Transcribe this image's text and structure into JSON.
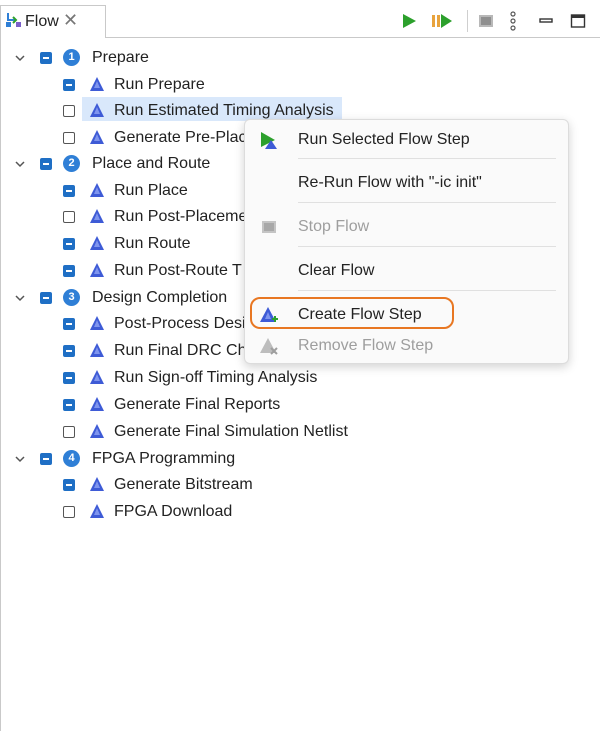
{
  "tab": {
    "title": "Flow",
    "close_glyph": "✕",
    "icon": "flow-navigator-icon"
  },
  "toolbar": {
    "buttons": [
      {
        "name": "run-flow-icon",
        "color": "#2ca02c"
      },
      {
        "name": "run-selected-step-icon",
        "color": "#2ca02c"
      },
      {
        "name": "stop-icon",
        "color": "#9e9e9e"
      },
      {
        "name": "view-menu-icon"
      },
      {
        "name": "minimize-icon"
      },
      {
        "name": "maximize-icon"
      }
    ]
  },
  "tree": {
    "stages": [
      {
        "number": "1",
        "label": "Prepare",
        "checked": true,
        "steps": [
          {
            "label": "Run Prepare",
            "checked": true
          },
          {
            "label": "Run Estimated Timing Analysis",
            "checked": false,
            "selected": true
          },
          {
            "label": "Generate Pre-Plac",
            "checked": false
          }
        ]
      },
      {
        "number": "2",
        "label": "Place and Route",
        "checked": true,
        "steps": [
          {
            "label": "Run Place",
            "checked": true
          },
          {
            "label": "Run Post-Placeme",
            "checked": false
          },
          {
            "label": "Run Route",
            "checked": true
          },
          {
            "label": "Run Post-Route T",
            "checked": true
          }
        ]
      },
      {
        "number": "3",
        "label": "Design Completion",
        "checked": true,
        "steps": [
          {
            "label": "Post-Process Desi",
            "checked": true
          },
          {
            "label": "Run Final DRC Ch",
            "checked": true
          },
          {
            "label": "Run Sign-off Timing Analysis",
            "checked": true
          },
          {
            "label": "Generate Final Reports",
            "checked": true
          },
          {
            "label": "Generate Final Simulation Netlist",
            "checked": false
          }
        ]
      },
      {
        "number": "4",
        "label": "FPGA Programming",
        "checked": true,
        "steps": [
          {
            "label": "Generate Bitstream",
            "checked": true
          },
          {
            "label": "FPGA Download",
            "checked": false
          }
        ]
      }
    ]
  },
  "context_menu": {
    "items": [
      {
        "label": "Run Selected Flow Step",
        "icon": "run-selected-step-icon",
        "enabled": true
      },
      {
        "label": "Re-Run Flow with \"-ic init\"",
        "icon": "",
        "enabled": true
      },
      {
        "label": "Stop Flow",
        "icon": "stop-icon",
        "enabled": false
      },
      {
        "label": "Clear Flow",
        "icon": "",
        "enabled": true
      },
      {
        "label": "Create Flow Step",
        "icon": "create-step-icon",
        "enabled": true,
        "highlighted": true
      },
      {
        "label": "Remove Flow Step",
        "icon": "remove-step-icon",
        "enabled": false
      }
    ]
  },
  "colors": {
    "accent_blue": "#1f6fc5",
    "selection": "#d9e8fb",
    "highlight_ring": "#e87722",
    "run_green": "#2ca02c"
  }
}
